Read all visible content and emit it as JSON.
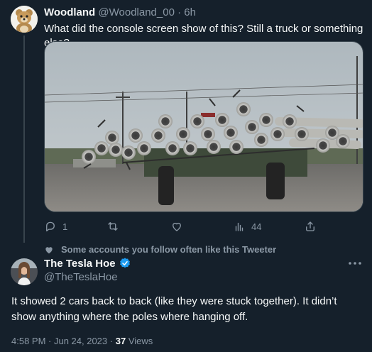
{
  "tweet1": {
    "name": "Woodland",
    "handle": "@Woodland_00",
    "separator": "·",
    "time": "6h",
    "text": "What did the console screen show of this? Still a truck or something else?",
    "media_icon": "photo-of-trailer-carrying-pipes",
    "actions": {
      "reply_count": "1",
      "retweet_count": "",
      "like_count": "",
      "views_count": "44"
    }
  },
  "social_context": {
    "text": "Some accounts you follow often like this Tweeter",
    "icon": "heart-icon"
  },
  "tweet2": {
    "name": "The Tesla Hoe",
    "verified_icon": "verified-badge-icon",
    "handle": "@TheTeslaHoe",
    "text": "It showed 2 cars back to back (like they were stuck together). It didn’t show anything where the poles where hanging off.",
    "timestamp": "4:58 PM · Jun 24, 2023 ·",
    "views_count": "37",
    "views_label": "Views"
  },
  "colors": {
    "background": "#15202b",
    "text": "#f7f9f9",
    "muted": "#8b98a5",
    "verified": "#1d9bf0",
    "border": "#38444d"
  }
}
